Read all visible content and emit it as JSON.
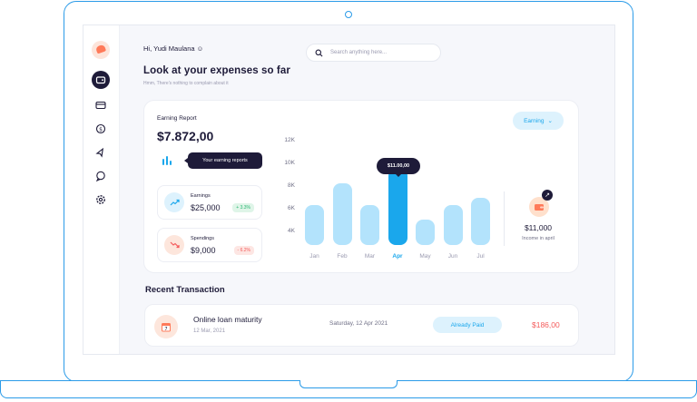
{
  "header": {
    "greeting": "Hi, Yudi Maulana",
    "title": "Look at your expenses so far",
    "subtitle": "Hmm, There's nothing to complain about it",
    "search_placeholder": "Search anything here..."
  },
  "sidebar": {
    "items": [
      "wallet-icon",
      "card-icon",
      "coin-icon",
      "rocket-icon",
      "chat-icon",
      "settings-icon"
    ]
  },
  "report": {
    "label": "Earning Report",
    "amount": "$7.872,00",
    "tooltip": "Your earning reports",
    "earnings": {
      "label": "Earnings",
      "value": "$25,000",
      "badge": "+ 3.3%"
    },
    "spendings": {
      "label": "Spendings",
      "value": "$9,000",
      "badge": "- 6.2%"
    },
    "dropdown": "Earning",
    "bar_tooltip": "$11.00,00",
    "income": {
      "value": "$11,000",
      "label": "Income in april"
    }
  },
  "chart_data": {
    "type": "bar",
    "categories": [
      "Jan",
      "Feb",
      "Mar",
      "Apr",
      "May",
      "Jun",
      "Jul"
    ],
    "values": [
      5500,
      8500,
      5500,
      10500,
      3500,
      5500,
      6500
    ],
    "y_ticks": [
      "12K",
      "10K",
      "8K",
      "6K",
      "4K"
    ],
    "ylim": [
      0,
      12000
    ],
    "highlight": "Apr",
    "colors": {
      "bar": "#b3e3fc",
      "highlight": "#1aa7ec"
    }
  },
  "recent": {
    "title": "Recent Transaction",
    "transactions": [
      {
        "name": "Online loan maturity",
        "date": "12 Mar, 2021",
        "time": "Saturday, 12 Apr 2021",
        "status": "Already Paid",
        "amount": "$186,00"
      }
    ]
  },
  "colors": {
    "accent": "#1aa7ec",
    "dark": "#1e1b39",
    "negative": "#f45b5b",
    "positive": "#2bb673"
  }
}
